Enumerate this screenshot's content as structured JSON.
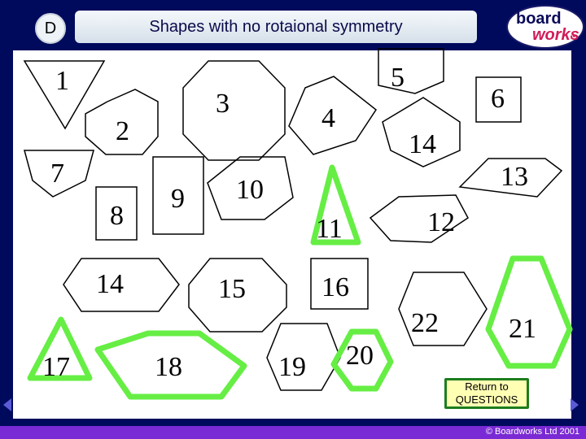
{
  "header": {
    "badge": "D",
    "title": "Shapes with no rotaional symmetry",
    "logo_top": "board",
    "logo_bottom": "works",
    "logo_dots": "•••"
  },
  "shapes": [
    {
      "id": "1",
      "label": "1",
      "highlighted": false
    },
    {
      "id": "2",
      "label": "2",
      "highlighted": false
    },
    {
      "id": "3",
      "label": "3",
      "highlighted": false
    },
    {
      "id": "4",
      "label": "4",
      "highlighted": false
    },
    {
      "id": "5",
      "label": "5",
      "highlighted": false
    },
    {
      "id": "6",
      "label": "6",
      "highlighted": false
    },
    {
      "id": "7",
      "label": "7",
      "highlighted": false
    },
    {
      "id": "8",
      "label": "8",
      "highlighted": false
    },
    {
      "id": "9",
      "label": "9",
      "highlighted": false
    },
    {
      "id": "10",
      "label": "10",
      "highlighted": false
    },
    {
      "id": "11",
      "label": "11",
      "highlighted": true
    },
    {
      "id": "12",
      "label": "12",
      "highlighted": false
    },
    {
      "id": "13",
      "label": "13",
      "highlighted": false
    },
    {
      "id": "14a",
      "label": "14",
      "highlighted": false
    },
    {
      "id": "14b",
      "label": "14",
      "highlighted": false
    },
    {
      "id": "15",
      "label": "15",
      "highlighted": false
    },
    {
      "id": "16",
      "label": "16",
      "highlighted": false
    },
    {
      "id": "17",
      "label": "17",
      "highlighted": true
    },
    {
      "id": "18",
      "label": "18",
      "highlighted": true
    },
    {
      "id": "19",
      "label": "19",
      "highlighted": false
    },
    {
      "id": "20",
      "label": "20",
      "highlighted": true
    },
    {
      "id": "21",
      "label": "21",
      "highlighted": false
    },
    {
      "id": "22",
      "label": "22",
      "highlighted": true
    }
  ],
  "return_button": {
    "line1": "Return to",
    "line2": "QUESTIONS"
  },
  "footer": {
    "copyright": "© Boardworks Ltd 2001"
  },
  "colors": {
    "background": "#000a5c",
    "highlight": "#66ee44",
    "outline": "#000000",
    "button_fill": "#ffffb4",
    "footer": "#7a2ad4"
  }
}
